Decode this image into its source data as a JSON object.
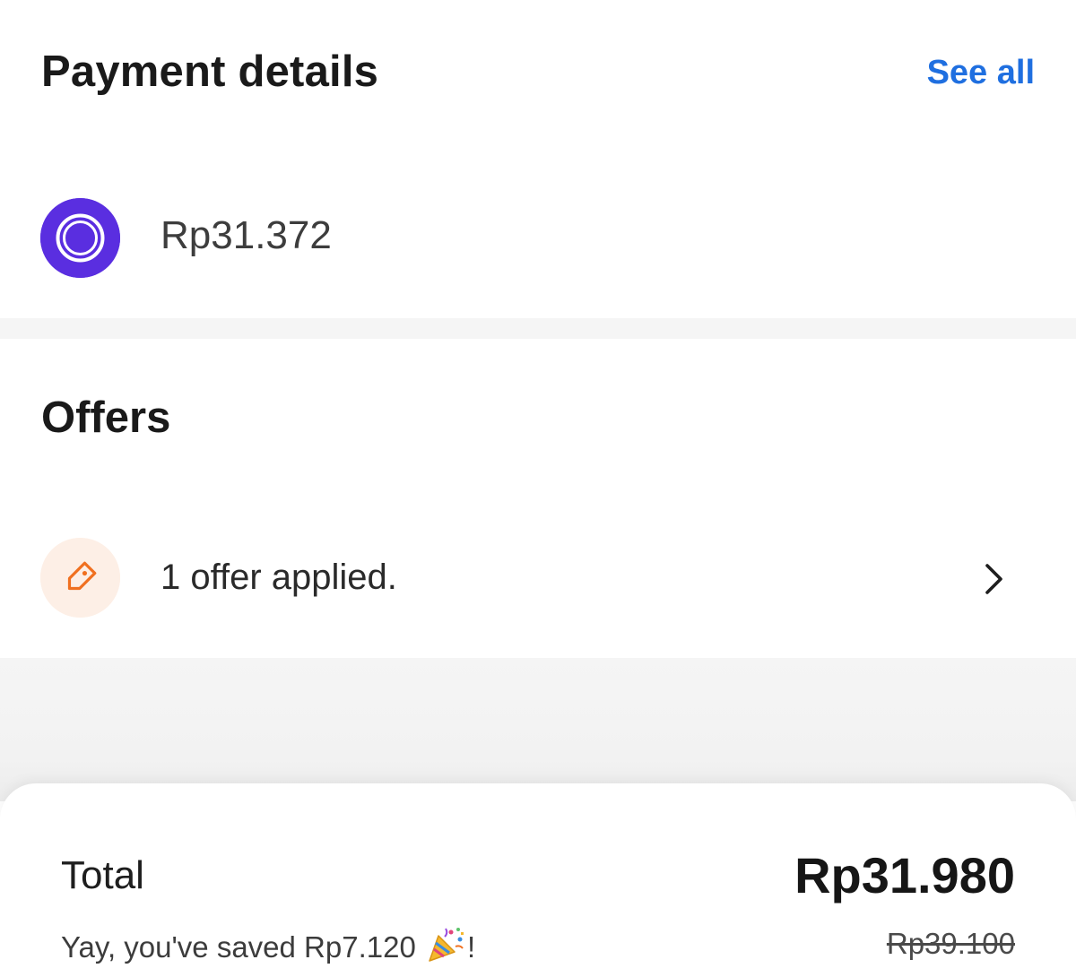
{
  "payment": {
    "title": "Payment details",
    "see_all": "See all",
    "wallet_icon": "wallet-circle-icon",
    "balance": "Rp31.372",
    "accent_color": "#5a2ee0"
  },
  "offers": {
    "title": "Offers",
    "icon": "price-tag-icon",
    "applied_text": "1 offer applied.",
    "chevron": "chevron-right-icon",
    "accent_color": "#f07020"
  },
  "summary": {
    "total_label": "Total",
    "total_value": "Rp31.980",
    "saved_text": "Yay, you've saved Rp7.120",
    "saved_suffix": "!",
    "party_icon": "party-popper-icon",
    "original_price": "Rp39.100"
  },
  "colors": {
    "link": "#1f6fe0",
    "divider": "#f5f5f5"
  }
}
